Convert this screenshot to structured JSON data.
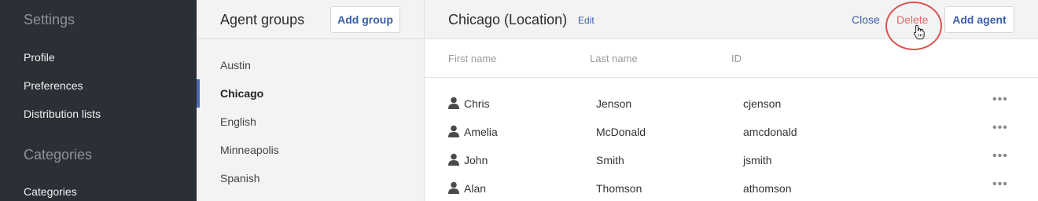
{
  "sidebar": {
    "settings_heading": "Settings",
    "settings_items": [
      {
        "label": "Profile"
      },
      {
        "label": "Preferences"
      },
      {
        "label": "Distribution lists"
      }
    ],
    "categories_heading": "Categories",
    "categories_items": [
      {
        "label": "Categories"
      }
    ]
  },
  "groups": {
    "title": "Agent groups",
    "add_label": "Add group",
    "items": [
      {
        "label": "Austin"
      },
      {
        "label": "Chicago"
      },
      {
        "label": "English"
      },
      {
        "label": "Minneapolis"
      },
      {
        "label": "Spanish"
      }
    ],
    "active": "Chicago"
  },
  "main": {
    "title": "Chicago (Location)",
    "edit_label": "Edit",
    "close_label": "Close",
    "delete_label": "Delete",
    "add_agent_label": "Add agent",
    "columns": [
      "First name",
      "Last name",
      "ID"
    ],
    "agents": [
      {
        "first": "Chris",
        "last": "Jenson",
        "id": "cjenson"
      },
      {
        "first": "Amelia",
        "last": "McDonald",
        "id": "amcdonald"
      },
      {
        "first": "John",
        "last": "Smith",
        "id": "jsmith"
      },
      {
        "first": "Alan",
        "last": "Thomson",
        "id": "athomson"
      }
    ],
    "more_glyph": "•••"
  },
  "colors": {
    "sidebar_bg": "#2b2f36",
    "accent": "#3a5fa8",
    "danger": "#e06969",
    "highlight": "#d9534f"
  },
  "icons": {
    "person": "person-icon",
    "more": "more-horizontal-icon",
    "cursor": "hand-pointer-icon"
  }
}
